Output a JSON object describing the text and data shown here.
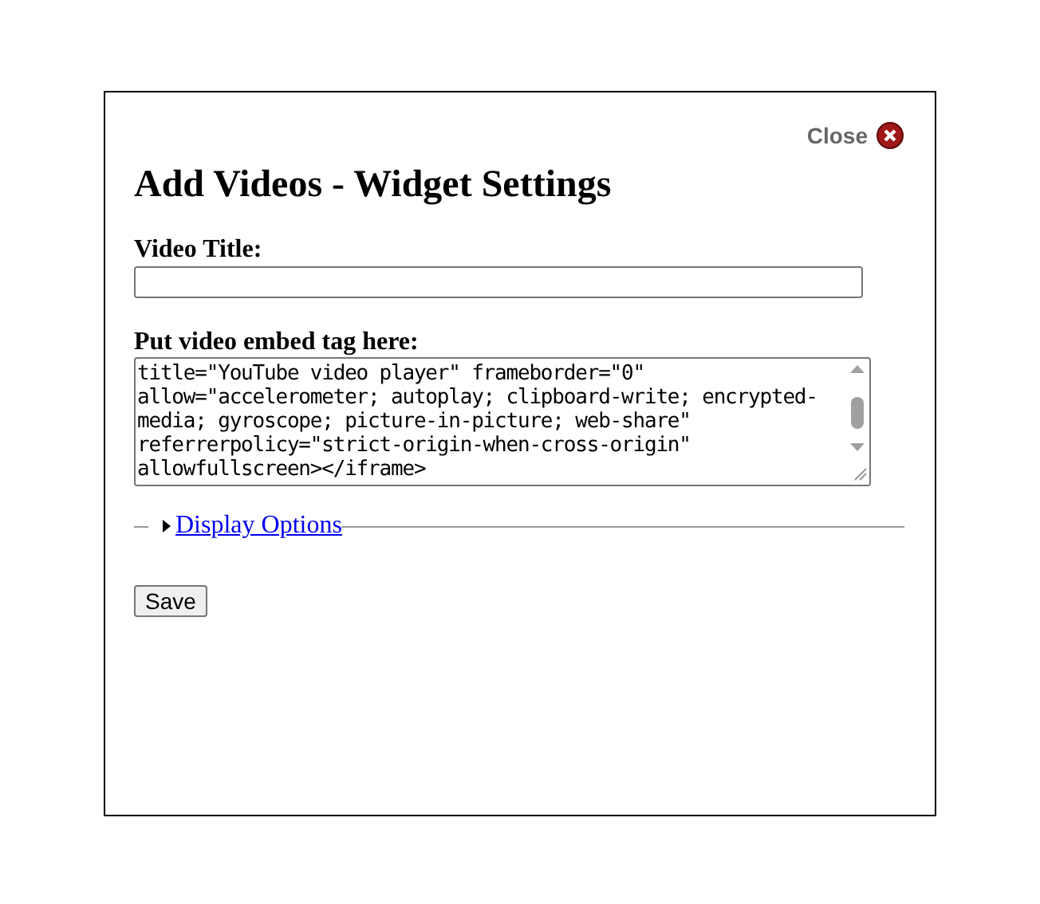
{
  "dialog": {
    "close_label": "Close",
    "title": "Add Videos - Widget Settings"
  },
  "fields": [
    {
      "kind": "text",
      "label": "Video Title:"
    },
    {
      "kind": "textarea",
      "label": "Put video embed tag here:",
      "lines": [
        "title=\"YouTube video player\" frameborder=\"0\"",
        "allow=\"accelerometer; autoplay; clipboard-write; encrypted-",
        "media; gyroscope; picture-in-picture; web-share\"",
        "referrerpolicy=\"strict-origin-when-cross-origin\"",
        "allowfullscreen></iframe>"
      ]
    }
  ],
  "display_options": {
    "label": "Display Options",
    "expanded": false
  },
  "buttons": [
    "Save"
  ]
}
